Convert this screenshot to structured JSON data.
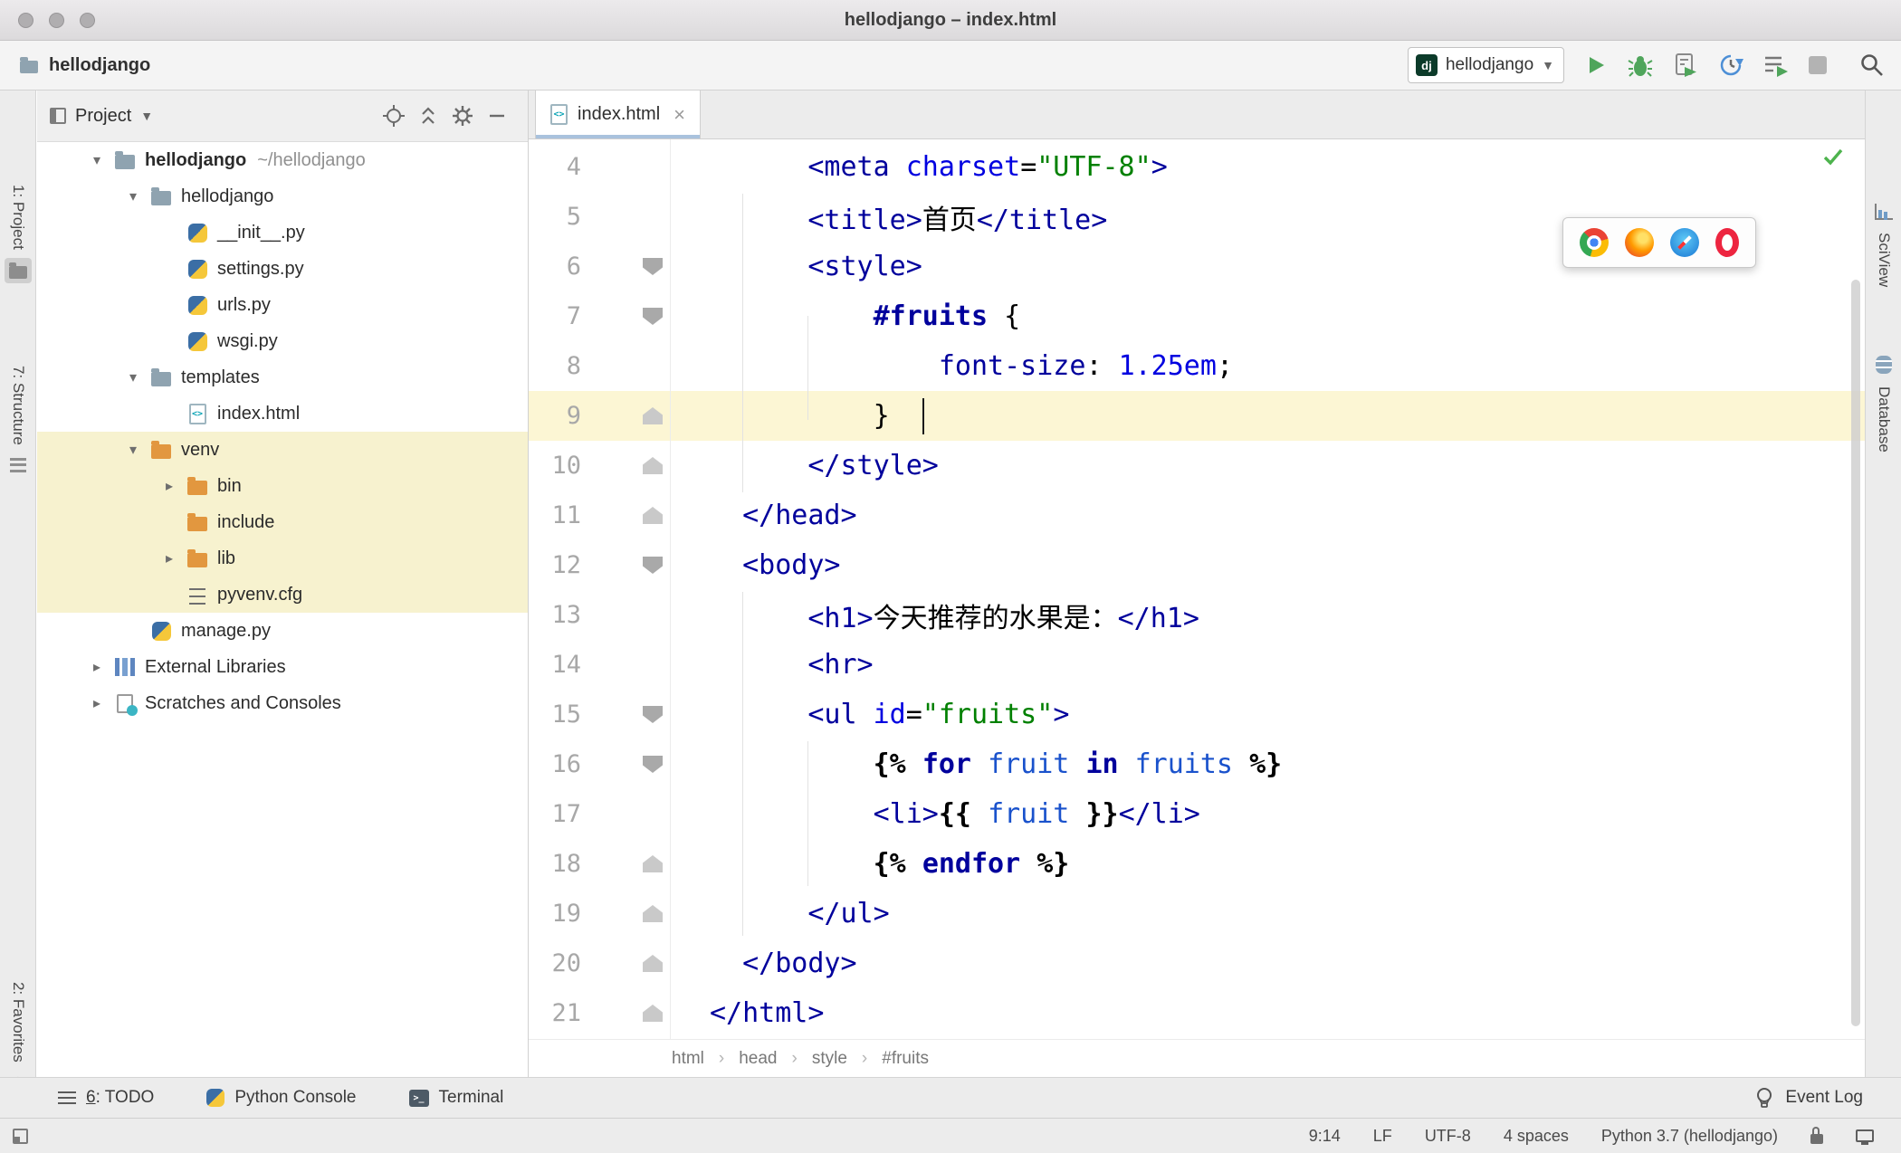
{
  "window": {
    "title": "hellodjango – index.html"
  },
  "toolbar": {
    "breadcrumb_project": "hellodjango",
    "run_config": {
      "badge": "dj",
      "name": "hellodjango"
    }
  },
  "tool_strips": {
    "left": [
      "1: Project",
      "7: Structure",
      "2: Favorites"
    ],
    "right": [
      "SciView",
      "Database"
    ]
  },
  "project_panel": {
    "title": "Project",
    "tree": [
      {
        "label": "hellodjango",
        "suffix": "~/hellodjango",
        "level": 0,
        "arrow": "open",
        "icon": "folder",
        "bold": true
      },
      {
        "label": "hellodjango",
        "level": 1,
        "arrow": "open",
        "icon": "folder"
      },
      {
        "label": "__init__.py",
        "level": 2,
        "icon": "python"
      },
      {
        "label": "settings.py",
        "level": 2,
        "icon": "python"
      },
      {
        "label": "urls.py",
        "level": 2,
        "icon": "python"
      },
      {
        "label": "wsgi.py",
        "level": 2,
        "icon": "python"
      },
      {
        "label": "templates",
        "level": 1,
        "arrow": "open",
        "icon": "folder"
      },
      {
        "label": "index.html",
        "level": 2,
        "icon": "html"
      },
      {
        "label": "venv",
        "level": 1,
        "arrow": "open",
        "icon": "folder-excluded",
        "highlight": true
      },
      {
        "label": "bin",
        "level": 2,
        "arrow": "closed",
        "icon": "folder-excluded",
        "highlight": true
      },
      {
        "label": "include",
        "level": 2,
        "icon": "folder-excluded",
        "highlight": true
      },
      {
        "label": "lib",
        "level": 2,
        "arrow": "closed",
        "icon": "folder-excluded",
        "highlight": true
      },
      {
        "label": "pyvenv.cfg",
        "level": 2,
        "icon": "config",
        "highlight": true
      },
      {
        "label": "manage.py",
        "level": 1,
        "icon": "python"
      },
      {
        "label": "External Libraries",
        "level": 0,
        "arrow": "closed",
        "icon": "libraries"
      },
      {
        "label": "Scratches and Consoles",
        "level": 0,
        "arrow": "closed",
        "icon": "scratches"
      }
    ]
  },
  "editor": {
    "tab": {
      "label": "index.html"
    },
    "breadcrumbs": [
      "html",
      "head",
      "style",
      "#fruits"
    ],
    "browser_popup": [
      "chrome",
      "firefox",
      "safari",
      "opera"
    ],
    "lines": [
      {
        "n": 4,
        "seg": [
          [
            "pl",
            "      "
          ],
          [
            "tag",
            "<meta"
          ],
          [
            "pl",
            " "
          ],
          [
            "attr",
            "charset"
          ],
          [
            "pl",
            "="
          ],
          [
            "str",
            "\"UTF-8\""
          ],
          [
            "tag",
            ">"
          ]
        ]
      },
      {
        "n": 5,
        "seg": [
          [
            "pl",
            "      "
          ],
          [
            "tag",
            "<title>"
          ],
          [
            "pl",
            "首页"
          ],
          [
            "tag",
            "</title>"
          ]
        ]
      },
      {
        "n": 6,
        "fold": "start",
        "seg": [
          [
            "pl",
            "      "
          ],
          [
            "tag",
            "<style>"
          ]
        ]
      },
      {
        "n": 7,
        "fold": "start",
        "seg": [
          [
            "pl",
            "          "
          ],
          [
            "kw",
            "#fruits"
          ],
          [
            "pl",
            " {"
          ]
        ]
      },
      {
        "n": 8,
        "seg": [
          [
            "pl",
            "              "
          ],
          [
            "tag",
            "font-size"
          ],
          [
            "pl",
            ": "
          ],
          [
            "attr",
            "1.25em"
          ],
          [
            "pl",
            ";"
          ]
        ]
      },
      {
        "n": 9,
        "fold": "end",
        "cur": true,
        "seg": [
          [
            "pl",
            "          }"
          ]
        ]
      },
      {
        "n": 10,
        "fold": "end",
        "seg": [
          [
            "pl",
            "      "
          ],
          [
            "tag",
            "</style>"
          ]
        ]
      },
      {
        "n": 11,
        "fold": "end",
        "seg": [
          [
            "pl",
            "  "
          ],
          [
            "tag",
            "</head>"
          ]
        ]
      },
      {
        "n": 12,
        "fold": "start",
        "seg": [
          [
            "pl",
            "  "
          ],
          [
            "tag",
            "<body>"
          ]
        ]
      },
      {
        "n": 13,
        "seg": [
          [
            "pl",
            "      "
          ],
          [
            "tag",
            "<h1>"
          ],
          [
            "pl",
            "今天推荐的水果是："
          ],
          [
            "tag",
            "</h1>"
          ]
        ]
      },
      {
        "n": 14,
        "seg": [
          [
            "pl",
            "      "
          ],
          [
            "tag",
            "<hr>"
          ]
        ]
      },
      {
        "n": 15,
        "fold": "start",
        "seg": [
          [
            "pl",
            "      "
          ],
          [
            "tag",
            "<ul"
          ],
          [
            "pl",
            " "
          ],
          [
            "attr",
            "id"
          ],
          [
            "pl",
            "="
          ],
          [
            "str",
            "\"fruits\""
          ],
          [
            "tag",
            ">"
          ]
        ]
      },
      {
        "n": 16,
        "fold": "start",
        "seg": [
          [
            "pl",
            "          "
          ],
          [
            "b",
            "{%"
          ],
          [
            "pl",
            " "
          ],
          [
            "kw",
            "for"
          ],
          [
            "pl",
            " "
          ],
          [
            "var",
            "fruit"
          ],
          [
            "pl",
            " "
          ],
          [
            "kw",
            "in"
          ],
          [
            "pl",
            " "
          ],
          [
            "var",
            "fruits"
          ],
          [
            "pl",
            " "
          ],
          [
            "b",
            "%}"
          ]
        ]
      },
      {
        "n": 17,
        "seg": [
          [
            "pl",
            "          "
          ],
          [
            "tag",
            "<li>"
          ],
          [
            "b",
            "{{"
          ],
          [
            "pl",
            " "
          ],
          [
            "var",
            "fruit"
          ],
          [
            "pl",
            " "
          ],
          [
            "b",
            "}}"
          ],
          [
            "tag",
            "</li>"
          ]
        ]
      },
      {
        "n": 18,
        "fold": "end",
        "seg": [
          [
            "pl",
            "          "
          ],
          [
            "b",
            "{%"
          ],
          [
            "pl",
            " "
          ],
          [
            "kw",
            "endfor"
          ],
          [
            "pl",
            " "
          ],
          [
            "b",
            "%}"
          ]
        ]
      },
      {
        "n": 19,
        "fold": "end",
        "seg": [
          [
            "pl",
            "      "
          ],
          [
            "tag",
            "</ul>"
          ]
        ]
      },
      {
        "n": 20,
        "fold": "end",
        "seg": [
          [
            "pl",
            "  "
          ],
          [
            "tag",
            "</body>"
          ]
        ]
      },
      {
        "n": 21,
        "fold": "end",
        "seg": [
          [
            "tag",
            "</html>"
          ]
        ]
      }
    ]
  },
  "bottom_bar": {
    "left": [
      {
        "mnemonic": "6",
        "label": ": TODO",
        "icon": "todo"
      },
      {
        "mnemonic": "",
        "label": "Python Console",
        "icon": "python-console"
      },
      {
        "mnemonic": "",
        "label": "Terminal",
        "icon": "terminal"
      }
    ],
    "right": {
      "label": "Event Log"
    }
  },
  "status_bar": {
    "caret_position": "9:14",
    "line_ending": "LF",
    "encoding": "UTF-8",
    "indent": "4 spaces",
    "interpreter": "Python 3.7 (hellodjango)"
  },
  "colors": {
    "tag": "#00009c",
    "attribute": "#0000e0",
    "string": "#008000",
    "keyword": "#00009c",
    "variable": "#1a52cc",
    "text": "#000000",
    "current_line": "#fcf6d4",
    "excluded_highlight": "#f7f2cf",
    "run_green": "#59a869"
  }
}
